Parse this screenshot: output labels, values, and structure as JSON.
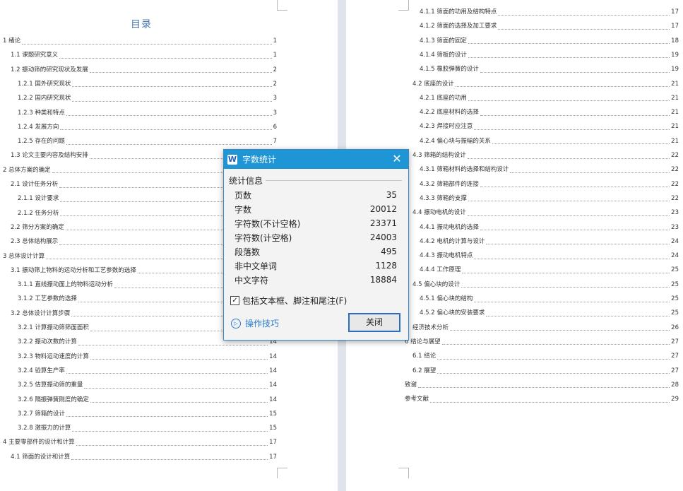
{
  "left_page": {
    "title": "目录",
    "entries": [
      {
        "label": "1 绪论",
        "page": "1",
        "indent": 0
      },
      {
        "label": "1.1 课题研究意义",
        "page": "1",
        "indent": 1
      },
      {
        "label": "1.2 振动筛的研究现状及发展",
        "page": "2",
        "indent": 1
      },
      {
        "label": "1.2.1 国外研究现状",
        "page": "2",
        "indent": 2
      },
      {
        "label": "1.2.2 国内研究现状",
        "page": "3",
        "indent": 2
      },
      {
        "label": "1.2.3 种类和特点",
        "page": "3",
        "indent": 2
      },
      {
        "label": "1.2.4 发展方向",
        "page": "6",
        "indent": 2
      },
      {
        "label": "1.2.5 存在的问题",
        "page": "7",
        "indent": 2
      },
      {
        "label": "1.3 论文主要内容及结构安排",
        "page": "",
        "indent": 1
      },
      {
        "label": "2 总体方案的确定",
        "page": "",
        "indent": 0
      },
      {
        "label": "2.1 设计任务分析",
        "page": "",
        "indent": 1
      },
      {
        "label": "2.1.1 设计要求",
        "page": "",
        "indent": 2
      },
      {
        "label": "2.1.2 任务分析",
        "page": "",
        "indent": 2
      },
      {
        "label": "2.2 筛分方案的确定",
        "page": "",
        "indent": 1
      },
      {
        "label": "2.3 总体结构展示",
        "page": "",
        "indent": 1
      },
      {
        "label": "3 总体设计计算",
        "page": "",
        "indent": 0
      },
      {
        "label": "3.1 振动筛上物料的运动分析和工艺参数的选择",
        "page": "",
        "indent": 1
      },
      {
        "label": "3.1.1 直线振动面上的物料运动分析",
        "page": "",
        "indent": 2
      },
      {
        "label": "3.1.2 工艺参数的选择",
        "page": "",
        "indent": 2
      },
      {
        "label": "3.2 总体设计计算步骤",
        "page": "",
        "indent": 1
      },
      {
        "label": "3.2.1 计算振动筛筛面面积",
        "page": "",
        "indent": 2
      },
      {
        "label": "3.2.2 振动次数的计算",
        "page": "14",
        "indent": 2
      },
      {
        "label": "3.2.3 物料运动速度的计算",
        "page": "14",
        "indent": 2
      },
      {
        "label": "3.2.4 验算生产率",
        "page": "14",
        "indent": 2
      },
      {
        "label": "3.2.5 估算振动筛的重量",
        "page": "14",
        "indent": 2
      },
      {
        "label": "3.2.6 隔振弹簧刚度的确定",
        "page": "14",
        "indent": 2
      },
      {
        "label": "3.2.7 筛箱的设计",
        "page": "15",
        "indent": 2
      },
      {
        "label": "3.2.8 激振力的计算",
        "page": "15",
        "indent": 2
      },
      {
        "label": "4 主要零部件的设计和计算",
        "page": "17",
        "indent": 0
      },
      {
        "label": "4.1 筛面的设计和计算",
        "page": "17",
        "indent": 1
      }
    ]
  },
  "right_page": {
    "entries": [
      {
        "label": "4.1.1 筛面的功用及结构特点",
        "page": "17",
        "indent": 2
      },
      {
        "label": "4.1.2 筛面的选择及加工要求",
        "page": "17",
        "indent": 2
      },
      {
        "label": "4.1.3 筛面的固定",
        "page": "18",
        "indent": 2
      },
      {
        "label": "4.1.4 筛板的设计",
        "page": "19",
        "indent": 2
      },
      {
        "label": "4.1.5 橡胶弹簧的设计",
        "page": "19",
        "indent": 2
      },
      {
        "label": "4.2 底座的设计",
        "page": "21",
        "indent": 1
      },
      {
        "label": "4.2.1 底座的功用",
        "page": "21",
        "indent": 2
      },
      {
        "label": "4.2.2 底座材料的选择",
        "page": "21",
        "indent": 2
      },
      {
        "label": "4.2.3 焊接时应注意",
        "page": "21",
        "indent": 2
      },
      {
        "label": "4.2.4 偏心块与振幅的关系",
        "page": "21",
        "indent": 2
      },
      {
        "label": "4.3 筛箱的结构设计",
        "page": "22",
        "indent": 1
      },
      {
        "label": "4.3.1 筛箱材料的选择和结构设计",
        "page": "22",
        "indent": 2
      },
      {
        "label": "4.3.2 筛箱部件的连接",
        "page": "22",
        "indent": 2
      },
      {
        "label": "4.3.3 筛箱的支撑",
        "page": "22",
        "indent": 2
      },
      {
        "label": "4.4 振动电机的设计",
        "page": "23",
        "indent": 1
      },
      {
        "label": "4.4.1 振动电机的选择",
        "page": "23",
        "indent": 2
      },
      {
        "label": "4.4.2 电机的计算与设计",
        "page": "24",
        "indent": 2
      },
      {
        "label": "4.4.3 振动电机特点",
        "page": "24",
        "indent": 2
      },
      {
        "label": "4.4.4 工作原理",
        "page": "25",
        "indent": 2
      },
      {
        "label": "4.5 偏心块的设计",
        "page": "25",
        "indent": 1
      },
      {
        "label": "4.5.1 偏心块的结构",
        "page": "25",
        "indent": 2
      },
      {
        "label": "4.5.2 偏心块的安装要求",
        "page": "25",
        "indent": 2
      },
      {
        "label": "经济技术分析",
        "page": "26",
        "indent": 1
      },
      {
        "label": "6 结论与展望",
        "page": "27",
        "indent": 0
      },
      {
        "label": "6.1 结论",
        "page": "27",
        "indent": 1
      },
      {
        "label": "6.2 展望",
        "page": "27",
        "indent": 1
      },
      {
        "label": "致谢",
        "page": "28",
        "indent": 0
      },
      {
        "label": "参考文献",
        "page": "29",
        "indent": 0
      }
    ]
  },
  "dialog": {
    "app_icon": "W",
    "title": "字数统计",
    "close_glyph": "✕",
    "section": "统计信息",
    "stats": [
      {
        "label": "页数",
        "value": "35"
      },
      {
        "label": "字数",
        "value": "20012"
      },
      {
        "label": "字符数(不计空格)",
        "value": "23371"
      },
      {
        "label": "字符数(计空格)",
        "value": "24003"
      },
      {
        "label": "段落数",
        "value": "495"
      },
      {
        "label": "非中文单词",
        "value": "1128"
      },
      {
        "label": "中文字符",
        "value": "18884"
      }
    ],
    "checkbox_label": "包括文本框、脚注和尾注(F)",
    "checkbox_checked": true,
    "tips_label": "操作技巧",
    "close_button": "关闭",
    "icons": {
      "app": "wps-writer-icon",
      "close": "close-icon",
      "tips": "play-circle-icon",
      "check": "checkmark-icon"
    },
    "colors": {
      "titlebar": "#1e95d4",
      "link": "#2a7ccd"
    }
  }
}
